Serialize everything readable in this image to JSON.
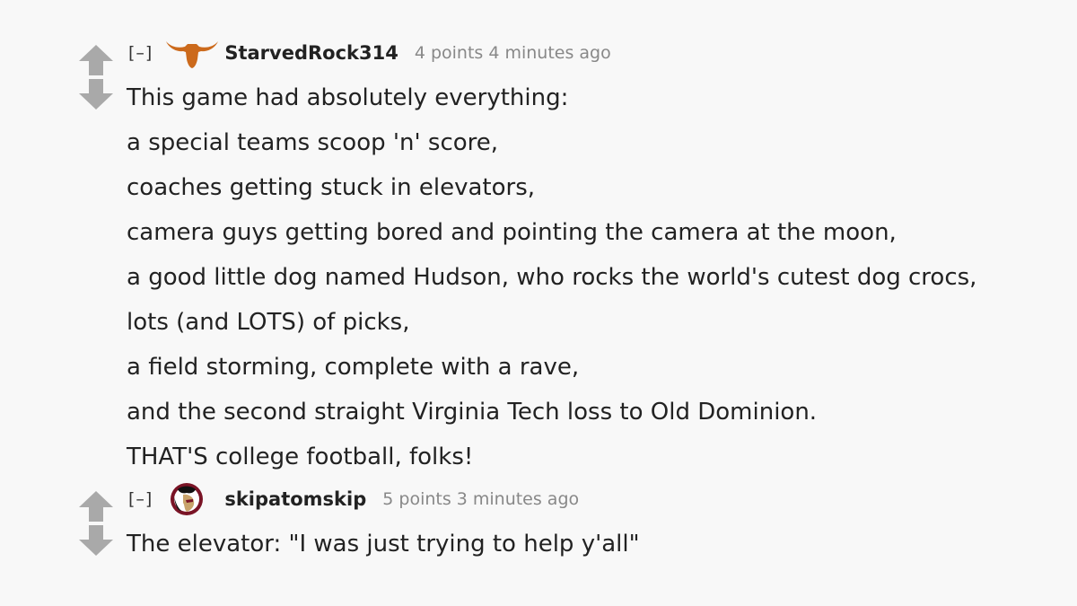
{
  "comments": [
    {
      "collapse_label": "[–]",
      "flair_icon": "longhorn-flair-icon",
      "flair_color": "#cc6a1c",
      "author": "StarvedRock314",
      "score": "4 points",
      "time": "4 minutes ago",
      "body": [
        "This game had absolutely everything:",
        "a special teams scoop 'n' score,",
        "coaches getting stuck in elevators,",
        "camera guys getting bored and pointing the camera at the moon,",
        "a good little dog named Hudson, who rocks the world's cutest dog crocs,",
        "lots (and LOTS) of picks,",
        "a field storming, complete with a rave,",
        "and the second straight Virginia Tech loss to Old Dominion.",
        "THAT'S college football, folks!"
      ]
    },
    {
      "collapse_label": "[–]",
      "flair_icon": "seminole-head-flair-icon",
      "flair_color": "#7a1426",
      "author": "skipatomskip",
      "score": "5 points",
      "time": "3 minutes ago",
      "body": [
        "The elevator: \"I was just trying to help y'all\""
      ]
    }
  ],
  "colors": {
    "background": "#f8f8f8",
    "vote_arrow": "#a9a9a9",
    "meta_text": "#888888"
  }
}
